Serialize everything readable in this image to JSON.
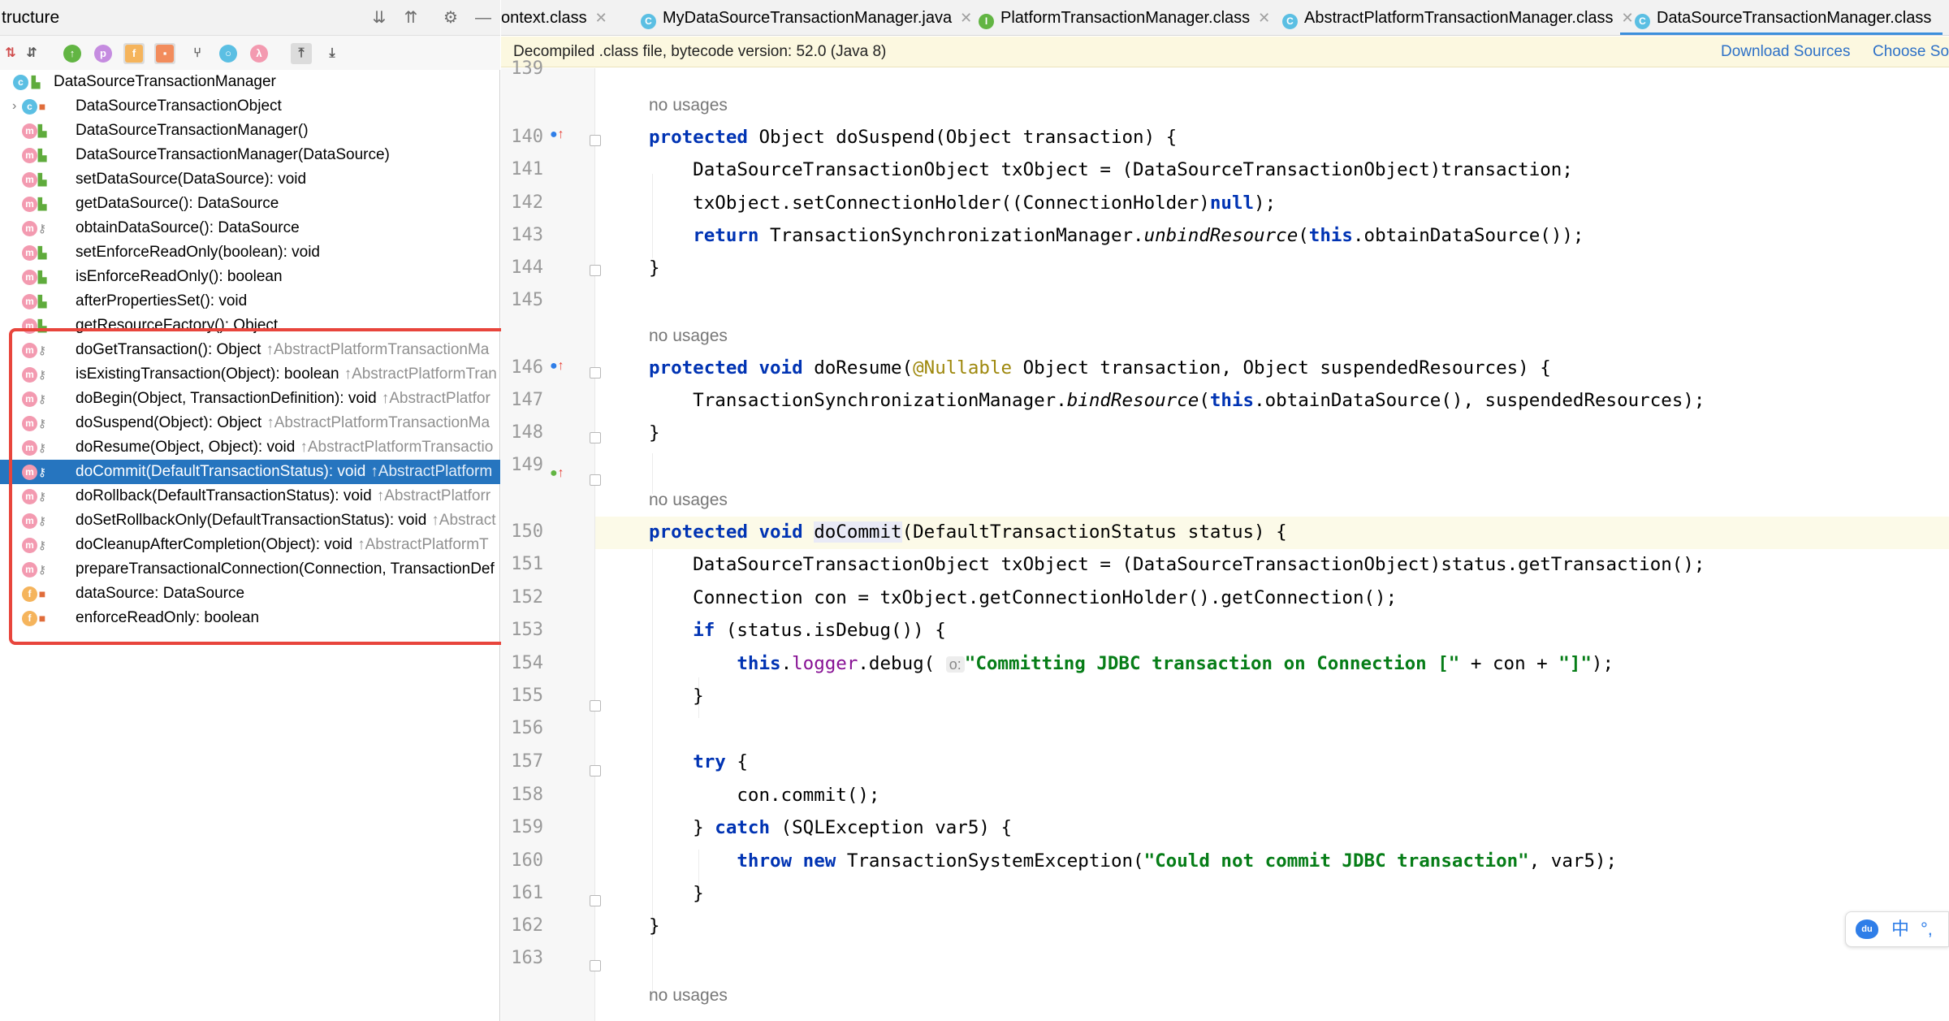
{
  "structure": {
    "title": "tructure",
    "toolbar_letters": {
      "p": "p",
      "f": "f",
      "lambda": "λ"
    },
    "tree": [
      {
        "label": "DataSourceTransactionManager",
        "icon": "class",
        "vis": "public",
        "indent": 0,
        "inherited": ""
      },
      {
        "label": "DataSourceTransactionObject",
        "icon": "class",
        "vis": "private",
        "indent": 1,
        "expandable": true,
        "inherited": ""
      },
      {
        "label": "DataSourceTransactionManager()",
        "icon": "method",
        "vis": "public",
        "indent": 1,
        "inherited": ""
      },
      {
        "label": "DataSourceTransactionManager(DataSource)",
        "icon": "method",
        "vis": "public",
        "indent": 1,
        "inherited": ""
      },
      {
        "label": "setDataSource(DataSource): void",
        "icon": "method",
        "vis": "public",
        "indent": 1,
        "inherited": ""
      },
      {
        "label": "getDataSource(): DataSource",
        "icon": "method",
        "vis": "public",
        "indent": 1,
        "inherited": ""
      },
      {
        "label": "obtainDataSource(): DataSource",
        "icon": "method",
        "vis": "protected",
        "indent": 1,
        "inherited": ""
      },
      {
        "label": "setEnforceReadOnly(boolean): void",
        "icon": "method",
        "vis": "public",
        "indent": 1,
        "inherited": ""
      },
      {
        "label": "isEnforceReadOnly(): boolean",
        "icon": "method",
        "vis": "public",
        "indent": 1,
        "inherited": ""
      },
      {
        "label": "afterPropertiesSet(): void",
        "icon": "method",
        "vis": "public",
        "indent": 1,
        "inherited": ""
      },
      {
        "label": "getResourceFactory(): Object",
        "icon": "method",
        "vis": "public",
        "indent": 1,
        "inherited": ""
      },
      {
        "label": "doGetTransaction(): Object",
        "icon": "method",
        "vis": "protected",
        "indent": 1,
        "inherited": "↑AbstractPlatformTransactionMa"
      },
      {
        "label": "isExistingTransaction(Object): boolean",
        "icon": "method",
        "vis": "protected",
        "indent": 1,
        "inherited": "↑AbstractPlatformTran"
      },
      {
        "label": "doBegin(Object, TransactionDefinition): void",
        "icon": "method",
        "vis": "protected",
        "indent": 1,
        "inherited": "↑AbstractPlatfor"
      },
      {
        "label": "doSuspend(Object): Object",
        "icon": "method",
        "vis": "protected",
        "indent": 1,
        "inherited": "↑AbstractPlatformTransactionMa"
      },
      {
        "label": "doResume(Object, Object): void",
        "icon": "method",
        "vis": "protected",
        "indent": 1,
        "inherited": "↑AbstractPlatformTransactio"
      },
      {
        "label": "doCommit(DefaultTransactionStatus): void",
        "icon": "method",
        "vis": "protected",
        "indent": 1,
        "inherited": "↑AbstractPlatform",
        "selected": true
      },
      {
        "label": "doRollback(DefaultTransactionStatus): void",
        "icon": "method",
        "vis": "protected",
        "indent": 1,
        "inherited": "↑AbstractPlatforr"
      },
      {
        "label": "doSetRollbackOnly(DefaultTransactionStatus): void",
        "icon": "method",
        "vis": "protected",
        "indent": 1,
        "inherited": "↑Abstract"
      },
      {
        "label": "doCleanupAfterCompletion(Object): void",
        "icon": "method",
        "vis": "protected",
        "indent": 1,
        "inherited": "↑AbstractPlatformT"
      },
      {
        "label": "prepareTransactionalConnection(Connection, TransactionDef",
        "icon": "method",
        "vis": "protected",
        "indent": 1,
        "inherited": ""
      },
      {
        "label": "dataSource: DataSource",
        "icon": "field",
        "vis": "private",
        "indent": 1,
        "inherited": ""
      },
      {
        "label": "enforceReadOnly: boolean",
        "icon": "field",
        "vis": "private",
        "indent": 1,
        "inherited": ""
      }
    ]
  },
  "tabs": [
    {
      "label": "ontext.class",
      "icon": "",
      "active": false
    },
    {
      "label": "MyDataSourceTransactionManager.java",
      "icon": "class",
      "active": false
    },
    {
      "label": "PlatformTransactionManager.class",
      "icon": "interface",
      "active": false
    },
    {
      "label": "AbstractPlatformTransactionManager.class",
      "icon": "class",
      "active": false
    },
    {
      "label": "DataSourceTransactionManager.class",
      "icon": "class",
      "active": true
    }
  ],
  "notice": {
    "text": "Decompiled .class file, bytecode version: 52.0 (Java 8)",
    "download": "Download Sources",
    "choose": "Choose So"
  },
  "editor": {
    "usage_hint": "no usages",
    "param_hint": "o:",
    "lines": [
      {
        "n": "139"
      },
      {
        "n": "140"
      },
      {
        "n": "141"
      },
      {
        "n": "142"
      },
      {
        "n": "143"
      },
      {
        "n": "144"
      },
      {
        "n": "145"
      },
      {
        "n": "146"
      },
      {
        "n": "147"
      },
      {
        "n": "148"
      },
      {
        "n": "149"
      },
      {
        "n": "150"
      },
      {
        "n": "151"
      },
      {
        "n": "152"
      },
      {
        "n": "153"
      },
      {
        "n": "154"
      },
      {
        "n": "155"
      },
      {
        "n": "156"
      },
      {
        "n": "157"
      },
      {
        "n": "158"
      },
      {
        "n": "159"
      },
      {
        "n": "160"
      },
      {
        "n": "161"
      },
      {
        "n": "162"
      },
      {
        "n": "163"
      }
    ]
  },
  "ime": {
    "brand": "du",
    "lang": "中",
    "punct": "°,"
  },
  "colors": {
    "selection": "#2675bf",
    "red_box": "#e8453c",
    "keyword": "#0033b3",
    "string": "#067d17",
    "annotation": "#9e880d"
  }
}
